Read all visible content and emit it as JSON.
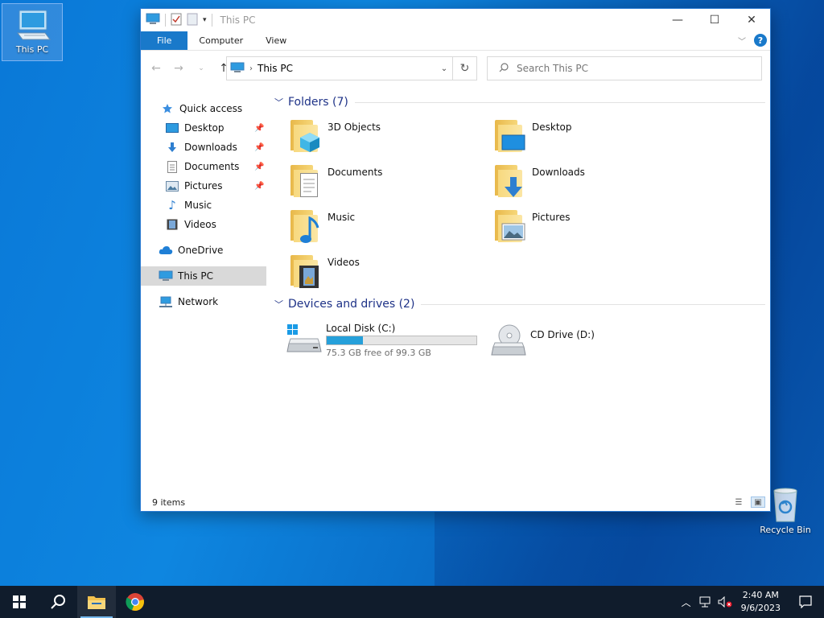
{
  "desktop": {
    "icons": [
      {
        "label": "This PC"
      },
      {
        "label": "Recycle Bin"
      }
    ]
  },
  "window": {
    "title": "This PC",
    "ribbon": {
      "tabs": [
        "File",
        "Computer",
        "View"
      ]
    },
    "address": {
      "crumb": "This PC"
    },
    "search": {
      "placeholder": "Search This PC"
    },
    "sidebar": {
      "items": [
        {
          "label": "Quick access",
          "icon": "star-icon"
        },
        {
          "label": "Desktop",
          "icon": "desktop-icon",
          "pinned": true
        },
        {
          "label": "Downloads",
          "icon": "download-icon",
          "pinned": true
        },
        {
          "label": "Documents",
          "icon": "document-icon",
          "pinned": true
        },
        {
          "label": "Pictures",
          "icon": "pictures-icon",
          "pinned": true
        },
        {
          "label": "Music",
          "icon": "music-icon"
        },
        {
          "label": "Videos",
          "icon": "videos-icon"
        },
        {
          "label": "OneDrive",
          "icon": "cloud-icon"
        },
        {
          "label": "This PC",
          "icon": "computer-icon",
          "selected": true
        },
        {
          "label": "Network",
          "icon": "network-icon"
        }
      ]
    },
    "folders_group": {
      "title": "Folders (7)",
      "items": [
        "3D Objects",
        "Desktop",
        "Documents",
        "Downloads",
        "Music",
        "Pictures",
        "Videos"
      ]
    },
    "drives_group": {
      "title": "Devices and drives (2)",
      "drives": [
        {
          "name": "Local Disk (C:)",
          "free_text": "75.3 GB free of 99.3 GB",
          "used_fraction": 0.242
        },
        {
          "name": "CD Drive (D:)"
        }
      ]
    },
    "status": {
      "item_count": "9 items"
    }
  },
  "taskbar": {
    "clock": {
      "time": "2:40 AM",
      "date": "9/6/2023"
    }
  },
  "colors": {
    "accent": "#1979ca",
    "drive_fill": "#26a0da",
    "group_header": "#1e3287",
    "taskbar": "#101c2c"
  }
}
